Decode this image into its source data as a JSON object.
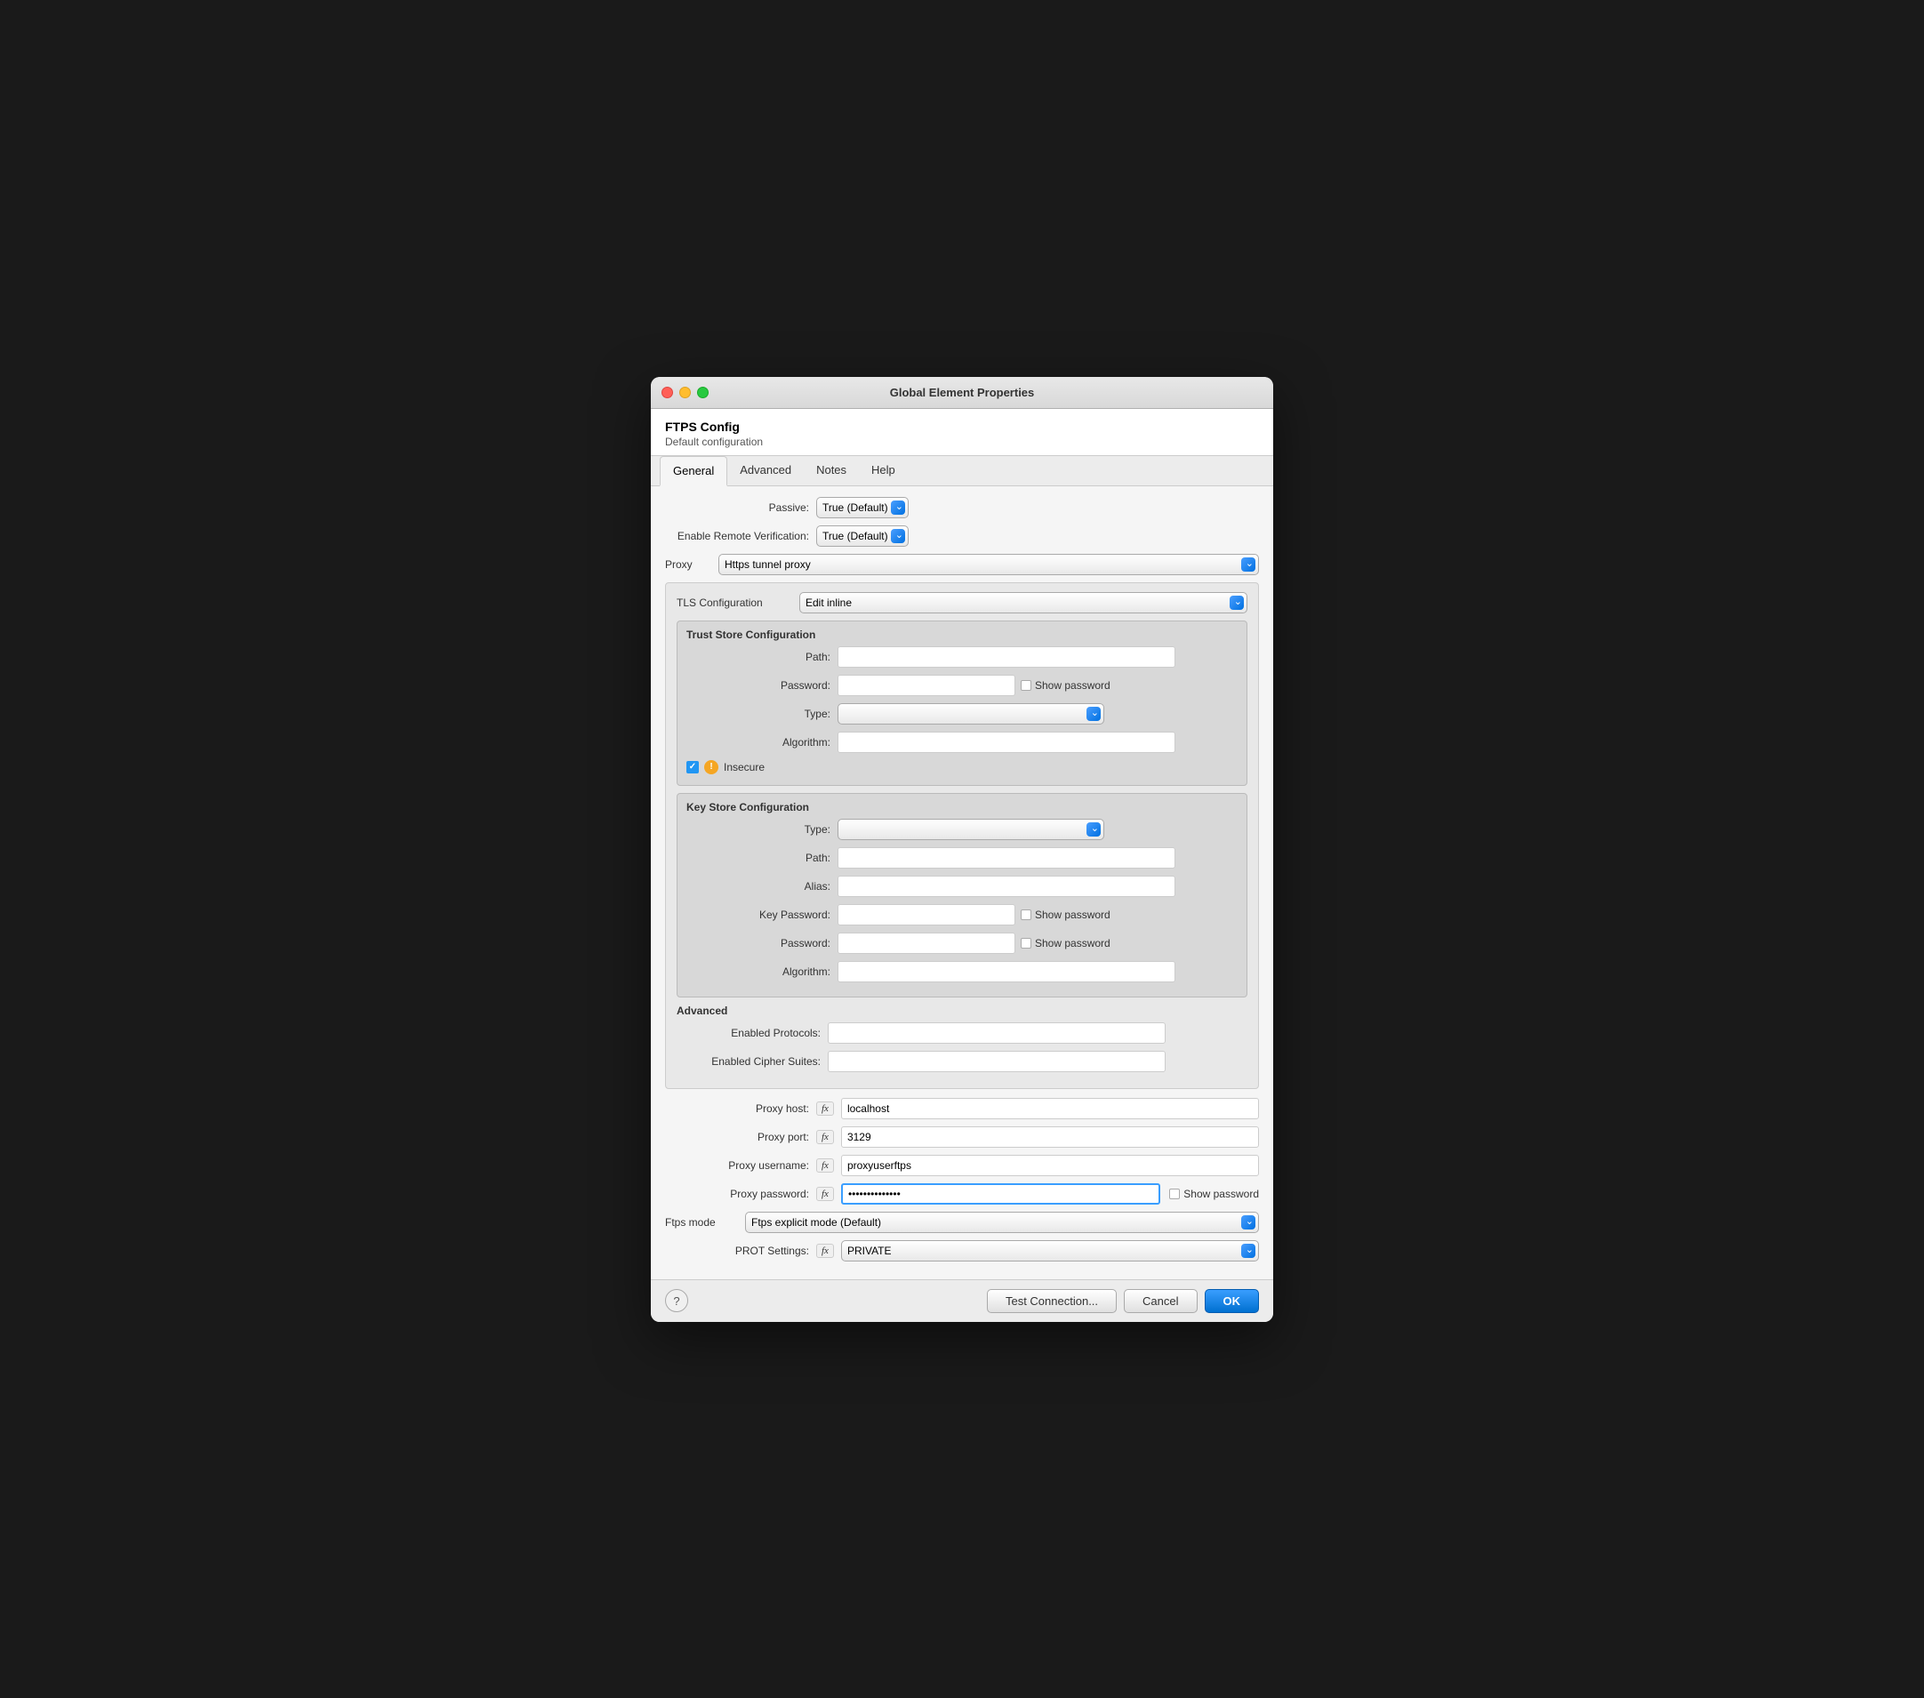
{
  "window": {
    "title": "Global Element Properties",
    "traffic_lights": [
      "red",
      "yellow",
      "green"
    ]
  },
  "header": {
    "title": "FTPS Config",
    "subtitle": "Default configuration"
  },
  "tabs": [
    {
      "label": "General",
      "active": true
    },
    {
      "label": "Advanced",
      "active": false
    },
    {
      "label": "Notes",
      "active": false
    },
    {
      "label": "Help",
      "active": false
    }
  ],
  "form": {
    "passive_label": "Passive:",
    "passive_value": "True (Default)",
    "enable_remote_label": "Enable Remote Verification:",
    "enable_remote_value": "True (Default)",
    "proxy_label": "Proxy",
    "proxy_value": "Https tunnel proxy",
    "tls_config_label": "TLS Configuration",
    "tls_config_value": "Edit inline",
    "trust_store_title": "Trust Store Configuration",
    "trust_store_path_label": "Path:",
    "trust_store_password_label": "Password:",
    "trust_store_type_label": "Type:",
    "trust_store_algorithm_label": "Algorithm:",
    "insecure_label": "Insecure",
    "show_password_label": "Show password",
    "key_store_title": "Key Store Configuration",
    "key_store_type_label": "Type:",
    "key_store_path_label": "Path:",
    "key_store_alias_label": "Alias:",
    "key_store_key_password_label": "Key Password:",
    "key_store_password_label": "Password:",
    "key_store_algorithm_label": "Algorithm:",
    "advanced_title": "Advanced",
    "enabled_protocols_label": "Enabled Protocols:",
    "enabled_cipher_suites_label": "Enabled Cipher Suites:",
    "proxy_host_label": "Proxy host:",
    "proxy_host_value": "localhost",
    "proxy_port_label": "Proxy port:",
    "proxy_port_value": "3129",
    "proxy_username_label": "Proxy username:",
    "proxy_username_value": "proxyuserftps",
    "proxy_password_label": "Proxy password:",
    "proxy_password_value": "••••••••••••••",
    "ftps_mode_label": "Ftps mode",
    "ftps_mode_value": "Ftps explicit mode (Default)",
    "prot_settings_label": "PROT Settings:",
    "prot_settings_value": "PRIVATE"
  },
  "buttons": {
    "test_connection": "Test Connection...",
    "cancel": "Cancel",
    "ok": "OK",
    "help": "?"
  }
}
